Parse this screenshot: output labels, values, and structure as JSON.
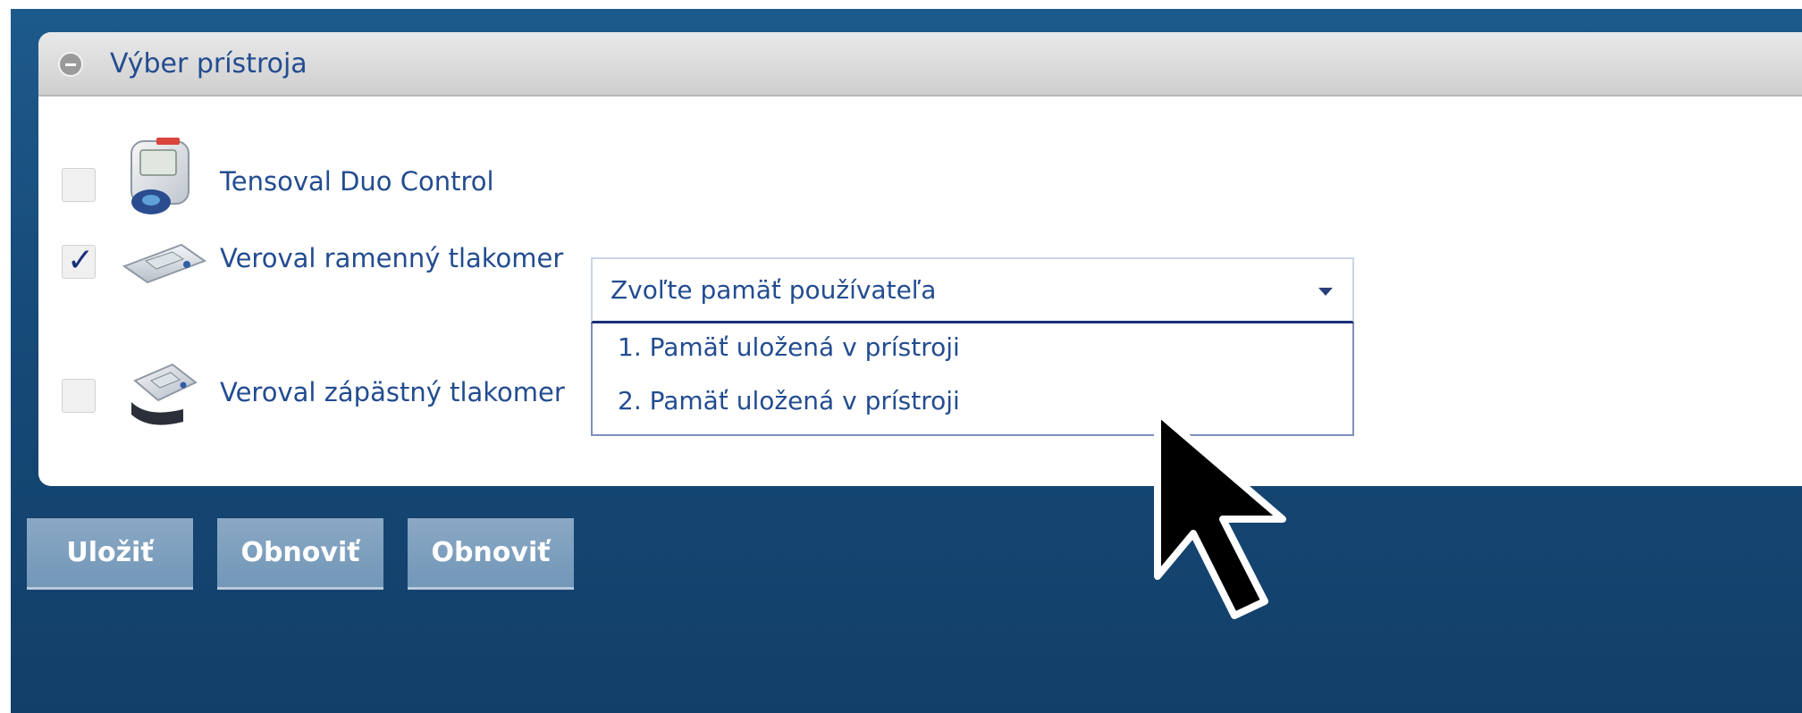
{
  "panel": {
    "title": "Výber prístroja"
  },
  "devices": [
    {
      "label": "Tensoval Duo Control",
      "checked": false,
      "image_icon": "wrist-monitor-device-image"
    },
    {
      "label": "Veroval ramenný tlakomer",
      "checked": true,
      "check_glyph": "✓",
      "image_icon": "upper-arm-monitor-device-image"
    },
    {
      "label": "Veroval zápästný tlakomer",
      "checked": false,
      "image_icon": "wrist-cuff-monitor-device-image"
    }
  ],
  "memory_select": {
    "value": "Zvoľte pamäť používateľa",
    "options": [
      "1. Pamäť uložená v prístroji",
      "2. Pamäť uložená v prístroji"
    ]
  },
  "buttons": {
    "save": "Uložiť",
    "refresh_1": "Obnoviť",
    "refresh_2": "Obnoviť"
  },
  "colors": {
    "background": "#164a78",
    "text": "#234c90",
    "button": "#7f9fbf"
  }
}
